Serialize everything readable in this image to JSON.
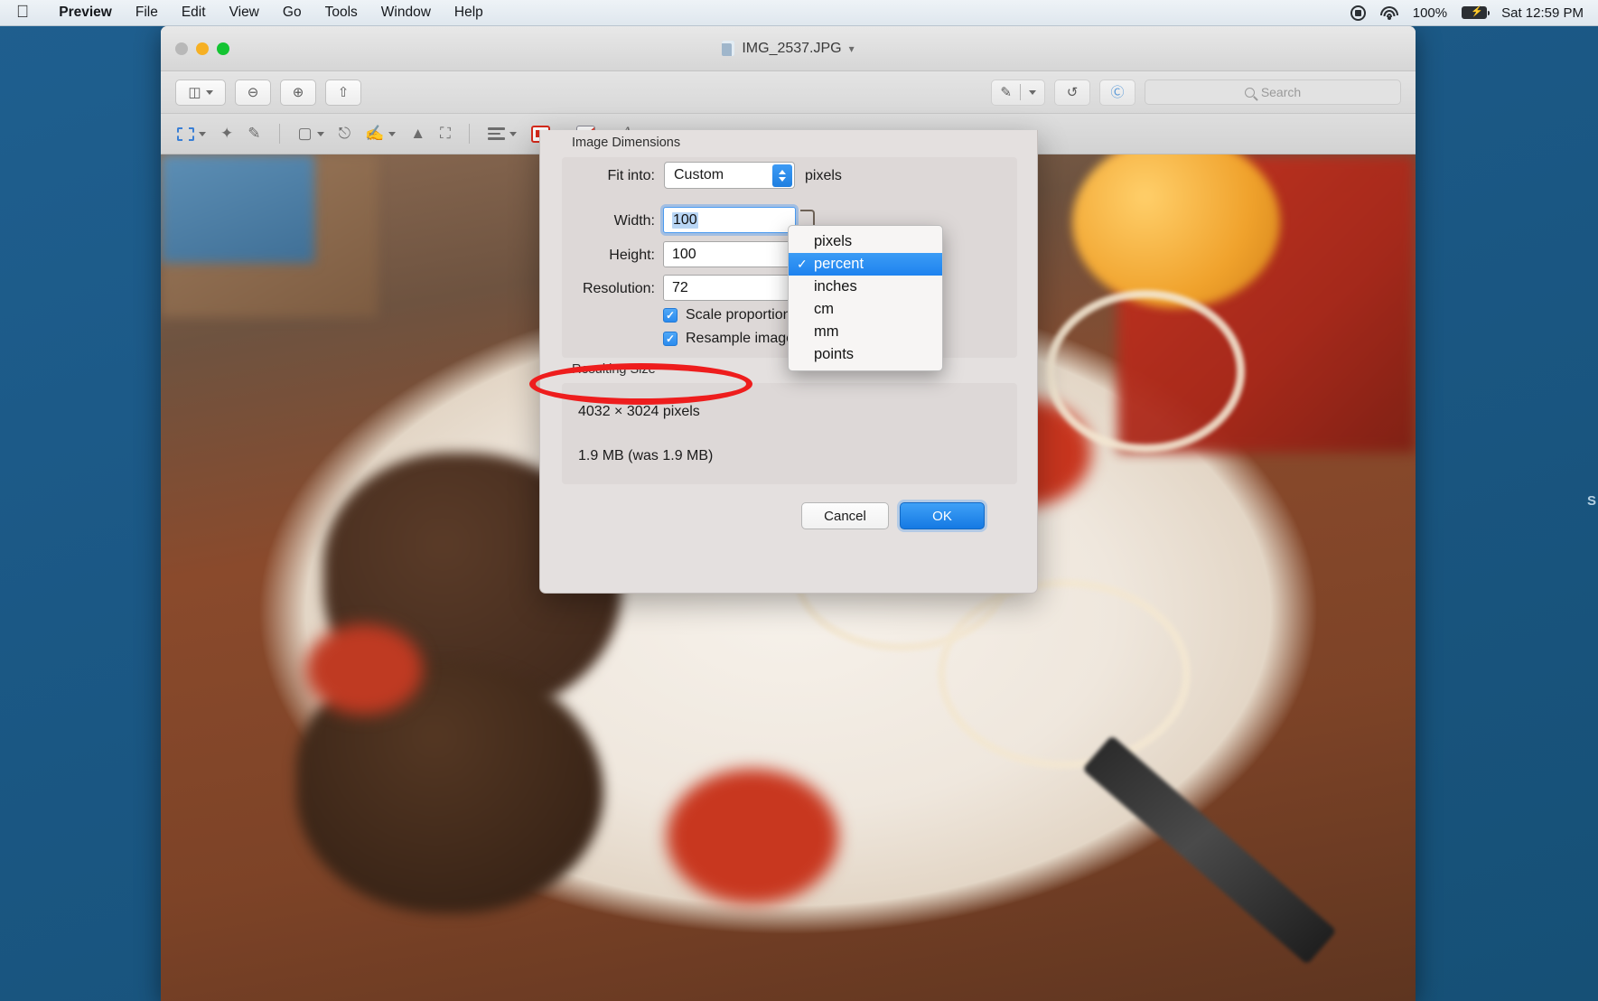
{
  "menubar": {
    "apple_icon": "apple-icon",
    "items": [
      "Preview",
      "File",
      "Edit",
      "View",
      "Go",
      "Tools",
      "Window",
      "Help"
    ],
    "status": {
      "record_icon": "screen-record-icon",
      "wifi_icon": "wifi-icon",
      "battery_percent": "100%",
      "battery_icon": "battery-charging-icon",
      "clock": "Sat 12:59 PM"
    }
  },
  "window": {
    "title": "IMG_2537.JPG",
    "title_chevron": "chevron-down-icon",
    "traffic": [
      "close",
      "minimize",
      "zoom"
    ],
    "toolbar": {
      "sidebar_icon": "sidebar-icon",
      "zoom_out_icon": "zoom-out-icon",
      "zoom_in_icon": "zoom-in-icon",
      "share_icon": "share-icon",
      "markup_icon": "markup-pen-icon",
      "rotate_icon": "rotate-left-icon",
      "annotate_icon": "annotate-icon",
      "search_placeholder": "Search"
    },
    "markup_toolbar": {
      "selection_icon": "rectangular-selection-icon",
      "instant_alpha_icon": "instant-alpha-wand-icon",
      "sketch_icon": "sketch-pen-icon",
      "shapes_icon": "shapes-icon",
      "text_icon": "text-box-icon",
      "sign_icon": "signature-icon",
      "adjust_color_icon": "adjust-color-icon",
      "adjust_size_icon": "adjust-size-icon",
      "text_style_icon": "text-alignment-icon",
      "border_color_icon": "border-color-icon",
      "fill_color_icon": "fill-color-icon",
      "font_icon": "font-icon"
    }
  },
  "dialog": {
    "section_dimensions": "Image Dimensions",
    "fit_into_label": "Fit into:",
    "fit_into_value": "Custom",
    "fit_into_unit": "pixels",
    "width_label": "Width:",
    "width_value": "100",
    "height_label": "Height:",
    "height_value": "100",
    "resolution_label": "Resolution:",
    "resolution_value": "72",
    "scale_proportionally_label": "Scale proportionally",
    "scale_proportionally_checked": true,
    "resample_label": "Resample image",
    "resample_checked": true,
    "section_result": "Resulting Size",
    "result_pixels": "4032 × 3024 pixels",
    "result_size": "1.9 MB (was 1.9 MB)",
    "cancel_label": "Cancel",
    "ok_label": "OK",
    "lock_icon": "link-lock-icon"
  },
  "unit_menu": {
    "items": [
      "pixels",
      "percent",
      "inches",
      "cm",
      "mm",
      "points"
    ],
    "selected": "percent",
    "check_glyph": "✓"
  },
  "annotation": {
    "shape": "red-ellipse-highlight",
    "color": "#ee1d1d",
    "targets": "Resample image"
  },
  "desktop": {
    "edge_text": "S",
    "accent": "#1f7fe0"
  }
}
